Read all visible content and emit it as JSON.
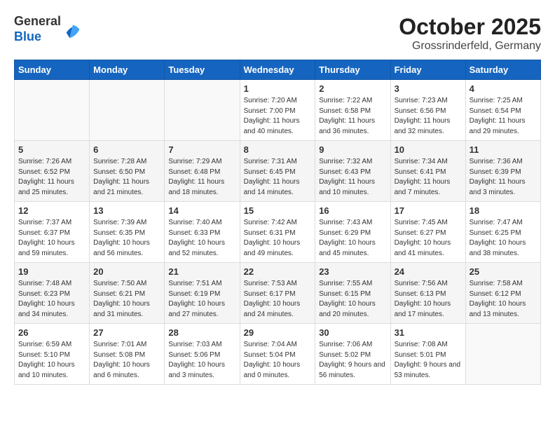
{
  "header": {
    "logo": {
      "line1": "General",
      "line2": "Blue"
    },
    "month": "October 2025",
    "location": "Grossrinderfeld, Germany"
  },
  "weekdays": [
    "Sunday",
    "Monday",
    "Tuesday",
    "Wednesday",
    "Thursday",
    "Friday",
    "Saturday"
  ],
  "weeks": [
    [
      {
        "day": "",
        "sunrise": "",
        "sunset": "",
        "daylight": ""
      },
      {
        "day": "",
        "sunrise": "",
        "sunset": "",
        "daylight": ""
      },
      {
        "day": "",
        "sunrise": "",
        "sunset": "",
        "daylight": ""
      },
      {
        "day": "1",
        "sunrise": "Sunrise: 7:20 AM",
        "sunset": "Sunset: 7:00 PM",
        "daylight": "Daylight: 11 hours and 40 minutes."
      },
      {
        "day": "2",
        "sunrise": "Sunrise: 7:22 AM",
        "sunset": "Sunset: 6:58 PM",
        "daylight": "Daylight: 11 hours and 36 minutes."
      },
      {
        "day": "3",
        "sunrise": "Sunrise: 7:23 AM",
        "sunset": "Sunset: 6:56 PM",
        "daylight": "Daylight: 11 hours and 32 minutes."
      },
      {
        "day": "4",
        "sunrise": "Sunrise: 7:25 AM",
        "sunset": "Sunset: 6:54 PM",
        "daylight": "Daylight: 11 hours and 29 minutes."
      }
    ],
    [
      {
        "day": "5",
        "sunrise": "Sunrise: 7:26 AM",
        "sunset": "Sunset: 6:52 PM",
        "daylight": "Daylight: 11 hours and 25 minutes."
      },
      {
        "day": "6",
        "sunrise": "Sunrise: 7:28 AM",
        "sunset": "Sunset: 6:50 PM",
        "daylight": "Daylight: 11 hours and 21 minutes."
      },
      {
        "day": "7",
        "sunrise": "Sunrise: 7:29 AM",
        "sunset": "Sunset: 6:48 PM",
        "daylight": "Daylight: 11 hours and 18 minutes."
      },
      {
        "day": "8",
        "sunrise": "Sunrise: 7:31 AM",
        "sunset": "Sunset: 6:45 PM",
        "daylight": "Daylight: 11 hours and 14 minutes."
      },
      {
        "day": "9",
        "sunrise": "Sunrise: 7:32 AM",
        "sunset": "Sunset: 6:43 PM",
        "daylight": "Daylight: 11 hours and 10 minutes."
      },
      {
        "day": "10",
        "sunrise": "Sunrise: 7:34 AM",
        "sunset": "Sunset: 6:41 PM",
        "daylight": "Daylight: 11 hours and 7 minutes."
      },
      {
        "day": "11",
        "sunrise": "Sunrise: 7:36 AM",
        "sunset": "Sunset: 6:39 PM",
        "daylight": "Daylight: 11 hours and 3 minutes."
      }
    ],
    [
      {
        "day": "12",
        "sunrise": "Sunrise: 7:37 AM",
        "sunset": "Sunset: 6:37 PM",
        "daylight": "Daylight: 10 hours and 59 minutes."
      },
      {
        "day": "13",
        "sunrise": "Sunrise: 7:39 AM",
        "sunset": "Sunset: 6:35 PM",
        "daylight": "Daylight: 10 hours and 56 minutes."
      },
      {
        "day": "14",
        "sunrise": "Sunrise: 7:40 AM",
        "sunset": "Sunset: 6:33 PM",
        "daylight": "Daylight: 10 hours and 52 minutes."
      },
      {
        "day": "15",
        "sunrise": "Sunrise: 7:42 AM",
        "sunset": "Sunset: 6:31 PM",
        "daylight": "Daylight: 10 hours and 49 minutes."
      },
      {
        "day": "16",
        "sunrise": "Sunrise: 7:43 AM",
        "sunset": "Sunset: 6:29 PM",
        "daylight": "Daylight: 10 hours and 45 minutes."
      },
      {
        "day": "17",
        "sunrise": "Sunrise: 7:45 AM",
        "sunset": "Sunset: 6:27 PM",
        "daylight": "Daylight: 10 hours and 41 minutes."
      },
      {
        "day": "18",
        "sunrise": "Sunrise: 7:47 AM",
        "sunset": "Sunset: 6:25 PM",
        "daylight": "Daylight: 10 hours and 38 minutes."
      }
    ],
    [
      {
        "day": "19",
        "sunrise": "Sunrise: 7:48 AM",
        "sunset": "Sunset: 6:23 PM",
        "daylight": "Daylight: 10 hours and 34 minutes."
      },
      {
        "day": "20",
        "sunrise": "Sunrise: 7:50 AM",
        "sunset": "Sunset: 6:21 PM",
        "daylight": "Daylight: 10 hours and 31 minutes."
      },
      {
        "day": "21",
        "sunrise": "Sunrise: 7:51 AM",
        "sunset": "Sunset: 6:19 PM",
        "daylight": "Daylight: 10 hours and 27 minutes."
      },
      {
        "day": "22",
        "sunrise": "Sunrise: 7:53 AM",
        "sunset": "Sunset: 6:17 PM",
        "daylight": "Daylight: 10 hours and 24 minutes."
      },
      {
        "day": "23",
        "sunrise": "Sunrise: 7:55 AM",
        "sunset": "Sunset: 6:15 PM",
        "daylight": "Daylight: 10 hours and 20 minutes."
      },
      {
        "day": "24",
        "sunrise": "Sunrise: 7:56 AM",
        "sunset": "Sunset: 6:13 PM",
        "daylight": "Daylight: 10 hours and 17 minutes."
      },
      {
        "day": "25",
        "sunrise": "Sunrise: 7:58 AM",
        "sunset": "Sunset: 6:12 PM",
        "daylight": "Daylight: 10 hours and 13 minutes."
      }
    ],
    [
      {
        "day": "26",
        "sunrise": "Sunrise: 6:59 AM",
        "sunset": "Sunset: 5:10 PM",
        "daylight": "Daylight: 10 hours and 10 minutes."
      },
      {
        "day": "27",
        "sunrise": "Sunrise: 7:01 AM",
        "sunset": "Sunset: 5:08 PM",
        "daylight": "Daylight: 10 hours and 6 minutes."
      },
      {
        "day": "28",
        "sunrise": "Sunrise: 7:03 AM",
        "sunset": "Sunset: 5:06 PM",
        "daylight": "Daylight: 10 hours and 3 minutes."
      },
      {
        "day": "29",
        "sunrise": "Sunrise: 7:04 AM",
        "sunset": "Sunset: 5:04 PM",
        "daylight": "Daylight: 10 hours and 0 minutes."
      },
      {
        "day": "30",
        "sunrise": "Sunrise: 7:06 AM",
        "sunset": "Sunset: 5:02 PM",
        "daylight": "Daylight: 9 hours and 56 minutes."
      },
      {
        "day": "31",
        "sunrise": "Sunrise: 7:08 AM",
        "sunset": "Sunset: 5:01 PM",
        "daylight": "Daylight: 9 hours and 53 minutes."
      },
      {
        "day": "",
        "sunrise": "",
        "sunset": "",
        "daylight": ""
      }
    ]
  ]
}
